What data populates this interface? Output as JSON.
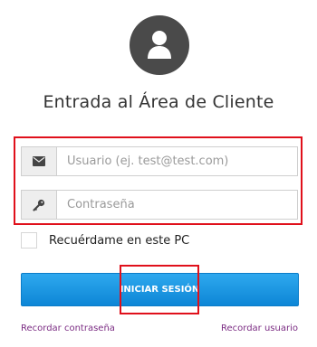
{
  "colors": {
    "avatar_bg": "#4a4a4a",
    "highlight": "#e0101b",
    "button": "#1a98e2",
    "link": "#7b2c83"
  },
  "header": {
    "avatar_icon": "user-icon",
    "title": "Entrada al Área de Cliente"
  },
  "form": {
    "username": {
      "icon": "envelope-icon",
      "placeholder": "Usuario (ej. test@test.com)",
      "value": ""
    },
    "password": {
      "icon": "key-icon",
      "placeholder": "Contraseña",
      "value": ""
    },
    "remember": {
      "label": "Recuérdame en este PC",
      "checked": false
    },
    "submit_label": "INICIAR SESIÓN"
  },
  "links": {
    "forgot_password": "Recordar contraseña",
    "forgot_username": "Recordar usuario"
  }
}
